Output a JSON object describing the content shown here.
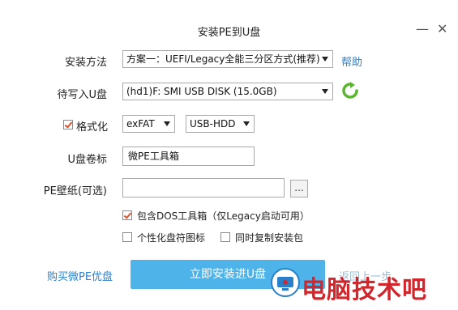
{
  "window": {
    "title": "安装PE到U盘",
    "minimize_glyph": "—",
    "close_glyph": "✕"
  },
  "install_method": {
    "label": "安装方法",
    "value": "方案一：UEFI/Legacy全能三分区方式(推荐)",
    "help": "帮助"
  },
  "target_disk": {
    "label": "待写入U盘",
    "value": "(hd1)F: SMI USB DISK (15.0GB)",
    "refresh_icon": "refresh-icon"
  },
  "format": {
    "label": "格式化",
    "checked": true,
    "filesystem": "exFAT",
    "mode": "USB-HDD"
  },
  "volume_label": {
    "label": "U盘卷标",
    "value": "微PE工具箱"
  },
  "wallpaper": {
    "label": "PE壁纸(可选)",
    "value": "",
    "browse": "..."
  },
  "options": {
    "dos_toolbox": "包含DOS工具箱（仅Legacy启动可用）",
    "dos_checked": true,
    "custom_icon": "个性化盘符图标",
    "custom_checked": false,
    "copy_installer": "同时复制安装包",
    "copy_checked": false
  },
  "footer": {
    "buy_link": "购买微PE优盘",
    "install_button": "立即安装进U盘",
    "back_link": "返回上一步"
  },
  "watermark": {
    "text": "电脑技术吧"
  },
  "colors": {
    "accent": "#4db3e8",
    "link": "#2a7fc9",
    "check": "#e0502a",
    "watermark": "#d1262b",
    "refresh": "#5cb531"
  }
}
